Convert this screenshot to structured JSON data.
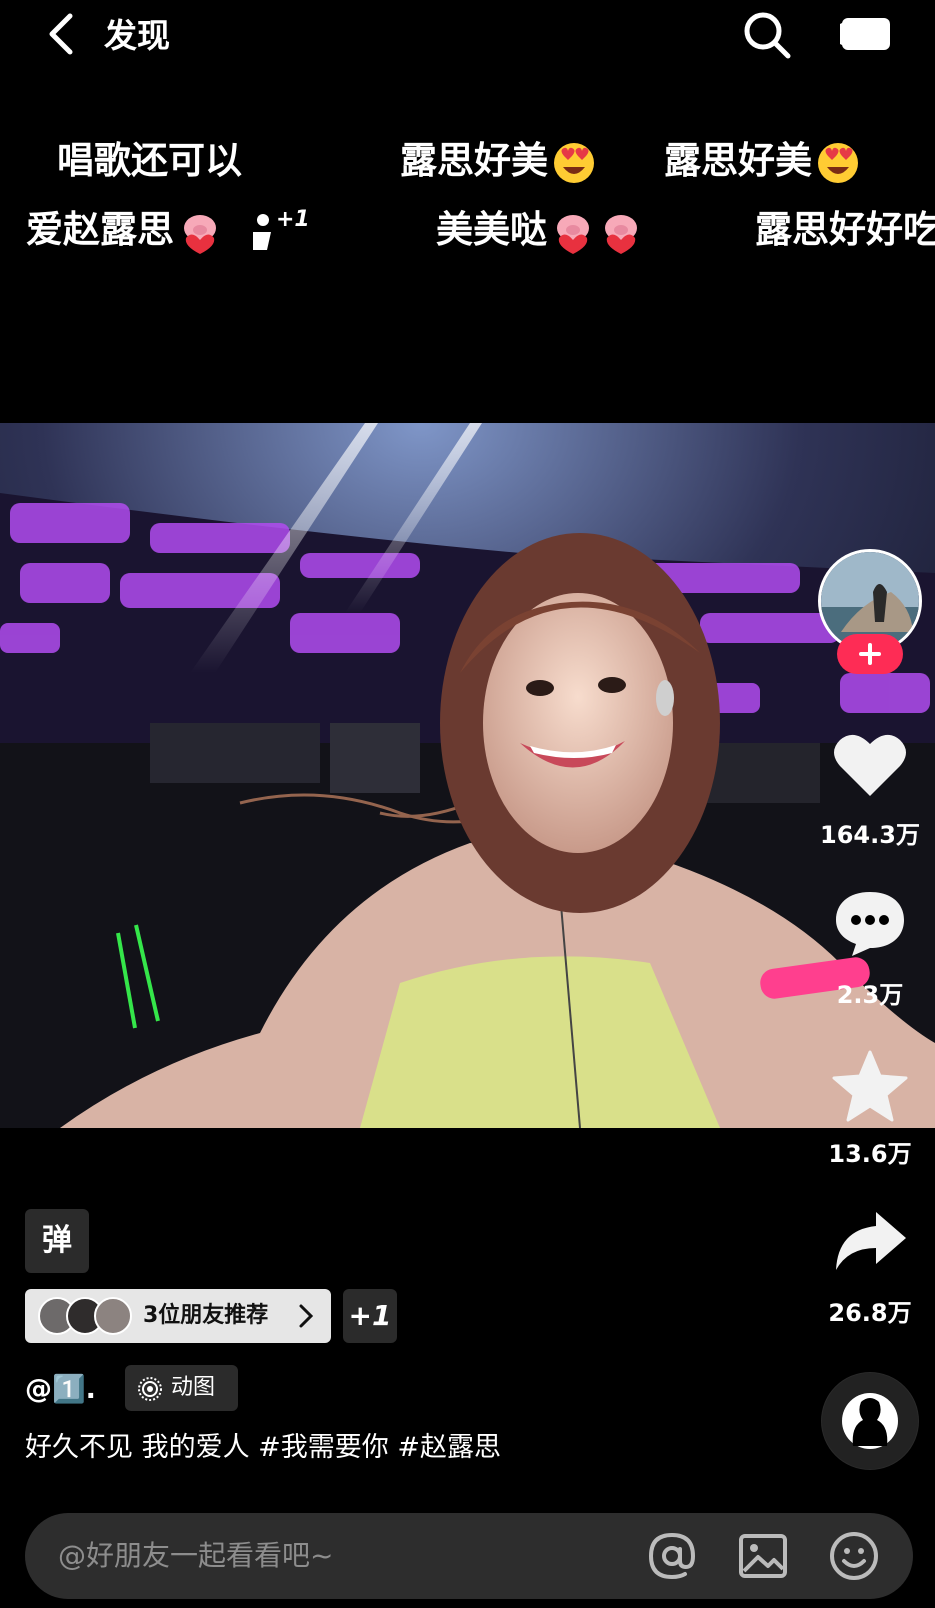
{
  "header": {
    "back_icon": "chevron-left-icon",
    "title": "发现",
    "search_icon": "search-icon",
    "cast_icon": "screen-cast-icon"
  },
  "danmaku": [
    {
      "text": "唱歌还可以",
      "emoji": ""
    },
    {
      "text": "露思好美",
      "emoji": "heart-eyes-emoji"
    },
    {
      "text": "露思好美",
      "emoji": "heart-eyes-emoji"
    },
    {
      "text": "爱赵露思",
      "emoji": "pig-heart-emoji",
      "plus": "+1"
    },
    {
      "text": "美美哒",
      "emoji": "pig-heart-emoji"
    },
    {
      "text": "露思好好吃",
      "emoji": ""
    }
  ],
  "side": {
    "likes": "164.3万",
    "comments": "2.3万",
    "favorites": "13.6万",
    "shares": "26.8万"
  },
  "info": {
    "app_icon_text": "弹",
    "friends_label": "3位朋友推荐",
    "plus_one": "+1",
    "author": "@1️⃣.",
    "dongtu_label": "动图",
    "caption": "好久不见 我的爱人 #我需要你 #赵露思"
  },
  "comment_bar": {
    "placeholder": "@好朋友一起看看吧~",
    "icons": [
      "at-icon",
      "image-icon",
      "emoji-icon"
    ]
  },
  "colors": {
    "accent": "#fe2c55",
    "background": "#000000",
    "pill": "#2b2b2b"
  }
}
